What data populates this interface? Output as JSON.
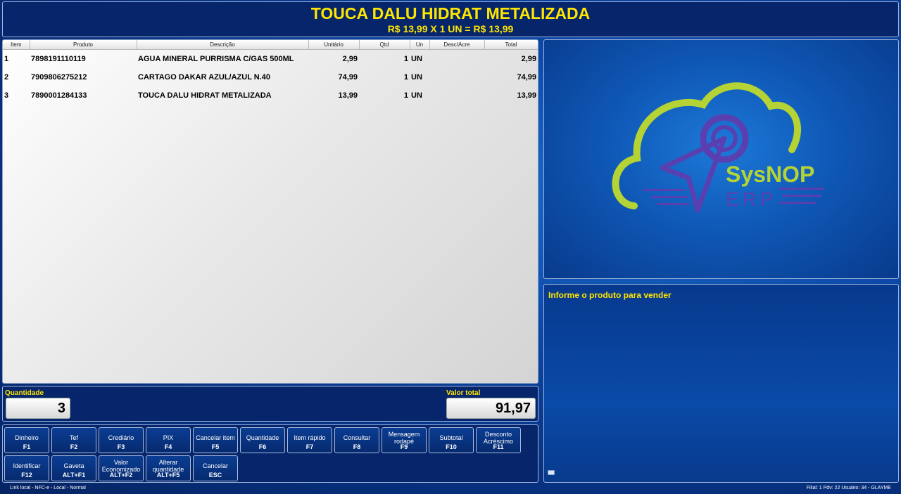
{
  "header": {
    "product_name": "TOUCA DALU HIDRAT METALIZADA",
    "price_line": "R$ 13,99  X  1 UN  =  R$ 13,99"
  },
  "table": {
    "columns": [
      "Item",
      "Produto",
      "Descrição",
      "Unitário",
      "Qtd",
      "Un",
      "Desc/Acre",
      "Total"
    ],
    "rows": [
      {
        "item": "1",
        "produto": "7898191110119",
        "descricao": "AGUA MINERAL PURRISMA C/GAS 500ML",
        "unitario": "2,99",
        "qtd": "1",
        "un": "UN",
        "desc": "",
        "total": "2,99"
      },
      {
        "item": "2",
        "produto": "7909806275212",
        "descricao": "CARTAGO DAKAR AZUL/AZUL N.40",
        "unitario": "74,99",
        "qtd": "1",
        "un": "UN",
        "desc": "",
        "total": "74,99"
      },
      {
        "item": "3",
        "produto": "7890001284133",
        "descricao": "TOUCA DALU HIDRAT METALIZADA",
        "unitario": "13,99",
        "qtd": "1",
        "un": "UN",
        "desc": "",
        "total": "13,99"
      }
    ]
  },
  "logo": {
    "name": "SysNOP",
    "sub": "ERP",
    "color_green": "#b5d334",
    "color_purple": "#5a3fb0"
  },
  "message": "Informe o produto para vender",
  "totals": {
    "quantidade_label": "Quantidade",
    "quantidade": "3",
    "valor_label": "Valor total",
    "valor": "91,97"
  },
  "fkeys": [
    {
      "label": "Dinheiro",
      "key": "F1"
    },
    {
      "label": "Tef",
      "key": "F2"
    },
    {
      "label": "Crediário",
      "key": "F3"
    },
    {
      "label": "PIX",
      "key": "F4"
    },
    {
      "label": "Cancelar item",
      "key": "F5"
    },
    {
      "label": "Quantidade",
      "key": "F6"
    },
    {
      "label": "Item rápido",
      "key": "F7"
    },
    {
      "label": "Consultar",
      "key": "F8"
    },
    {
      "label": "Mensagem rodapé",
      "key": "F9"
    },
    {
      "label": "Subtotal",
      "key": "F10"
    },
    {
      "label": "Desconto Acréscimo",
      "key": "F11"
    },
    {
      "label": "Identificar",
      "key": "F12"
    },
    {
      "label": "Gaveta",
      "key": "ALT+F1"
    },
    {
      "label": "Valor Economizado",
      "key": "ALT+F2"
    },
    {
      "label": "Alterar quantidade",
      "key": "ALT+F5"
    },
    {
      "label": "Cancelar",
      "key": "ESC"
    }
  ],
  "status": {
    "left": "Link local - NFC-e - Local - Normal",
    "right": "Filial: 1   Pdv: 22  Usuário: 34 - GLAYME"
  }
}
